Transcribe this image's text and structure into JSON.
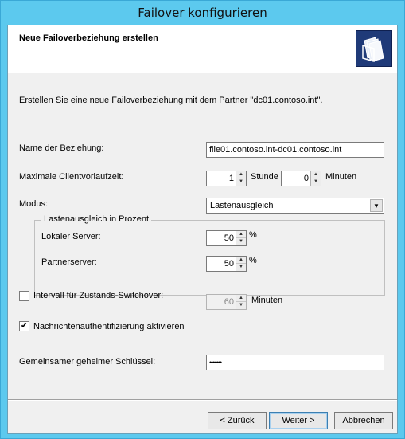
{
  "window": {
    "title": "Failover konfigurieren"
  },
  "header": {
    "title": "Neue Failoverbeziehung erstellen",
    "icon": "folder-documents-icon"
  },
  "description": "Erstellen Sie eine neue Failoverbeziehung mit dem Partner \"dc01.contoso.int\".",
  "form": {
    "name_label": "Name der Beziehung:",
    "name_value": "file01.contoso.int-dc01.contoso.int",
    "mclt_label": "Maximale Clientvorlaufzeit:",
    "mclt_hours": "1",
    "mclt_hours_unit": "Stunde",
    "mclt_minutes": "0",
    "mclt_minutes_unit": "Minuten",
    "mode_label": "Modus:",
    "mode_value": "Lastenausgleich",
    "group_label": "Lastenausgleich in Prozent",
    "local_label": "Lokaler Server:",
    "local_value": "50",
    "partner_label": "Partnerserver:",
    "partner_value": "50",
    "percent_unit": "%",
    "switchover_label": "Intervall für Zustands-Switchover:",
    "switchover_checked": false,
    "switchover_value": "60",
    "switchover_unit": "Minuten",
    "auth_label": "Nachrichtenauthentifizierung aktivieren",
    "auth_checked": true,
    "secret_label": "Gemeinsamer geheimer Schlüssel:",
    "secret_value": "•••••••"
  },
  "buttons": {
    "back": "< Zurück",
    "next": "Weiter >",
    "cancel": "Abbrechen"
  }
}
